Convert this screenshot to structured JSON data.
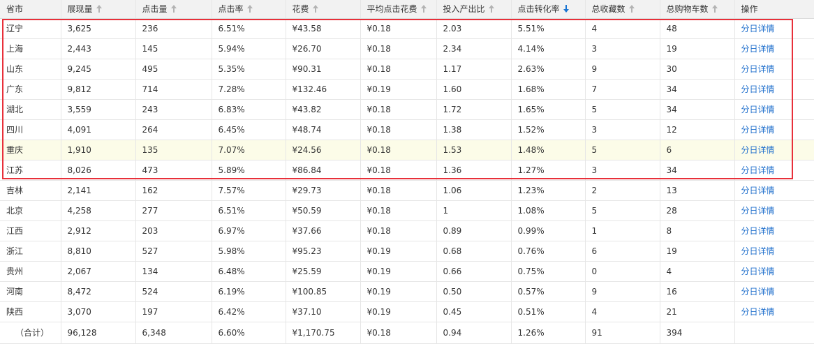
{
  "columns": [
    {
      "key": "province",
      "label": "省市",
      "sort": "none"
    },
    {
      "key": "impressions",
      "label": "展现量",
      "sort": "up"
    },
    {
      "key": "clicks",
      "label": "点击量",
      "sort": "up"
    },
    {
      "key": "ctr",
      "label": "点击率",
      "sort": "up"
    },
    {
      "key": "cost",
      "label": "花费",
      "sort": "up"
    },
    {
      "key": "cpc",
      "label": "平均点击花费",
      "sort": "up"
    },
    {
      "key": "roi",
      "label": "投入产出比",
      "sort": "up"
    },
    {
      "key": "cvr",
      "label": "点击转化率",
      "sort": "down-active"
    },
    {
      "key": "favorites",
      "label": "总收藏数",
      "sort": "up"
    },
    {
      "key": "cart",
      "label": "总购物车数",
      "sort": "up"
    },
    {
      "key": "action",
      "label": "操作",
      "sort": "none"
    }
  ],
  "action_link_label": "分日详情",
  "rows": [
    [
      "辽宁",
      "3,625",
      "236",
      "6.51%",
      "¥43.58",
      "¥0.18",
      "2.03",
      "5.51%",
      "4",
      "48"
    ],
    [
      "上海",
      "2,443",
      "145",
      "5.94%",
      "¥26.70",
      "¥0.18",
      "2.34",
      "4.14%",
      "3",
      "19"
    ],
    [
      "山东",
      "9,245",
      "495",
      "5.35%",
      "¥90.31",
      "¥0.18",
      "1.17",
      "2.63%",
      "9",
      "30"
    ],
    [
      "广东",
      "9,812",
      "714",
      "7.28%",
      "¥132.46",
      "¥0.19",
      "1.60",
      "1.68%",
      "7",
      "34"
    ],
    [
      "湖北",
      "3,559",
      "243",
      "6.83%",
      "¥43.82",
      "¥0.18",
      "1.72",
      "1.65%",
      "5",
      "34"
    ],
    [
      "四川",
      "4,091",
      "264",
      "6.45%",
      "¥48.74",
      "¥0.18",
      "1.38",
      "1.52%",
      "3",
      "12"
    ],
    [
      "重庆",
      "1,910",
      "135",
      "7.07%",
      "¥24.56",
      "¥0.18",
      "1.53",
      "1.48%",
      "5",
      "6"
    ],
    [
      "江苏",
      "8,026",
      "473",
      "5.89%",
      "¥86.84",
      "¥0.18",
      "1.36",
      "1.27%",
      "3",
      "34"
    ],
    [
      "吉林",
      "2,141",
      "162",
      "7.57%",
      "¥29.73",
      "¥0.18",
      "1.06",
      "1.23%",
      "2",
      "13"
    ],
    [
      "北京",
      "4,258",
      "277",
      "6.51%",
      "¥50.59",
      "¥0.18",
      "1",
      "1.08%",
      "5",
      "28"
    ],
    [
      "江西",
      "2,912",
      "203",
      "6.97%",
      "¥37.66",
      "¥0.18",
      "0.89",
      "0.99%",
      "1",
      "8"
    ],
    [
      "浙江",
      "8,810",
      "527",
      "5.98%",
      "¥95.23",
      "¥0.19",
      "0.68",
      "0.76%",
      "6",
      "19"
    ],
    [
      "贵州",
      "2,067",
      "134",
      "6.48%",
      "¥25.59",
      "¥0.19",
      "0.66",
      "0.75%",
      "0",
      "4"
    ],
    [
      "河南",
      "8,472",
      "524",
      "6.19%",
      "¥100.85",
      "¥0.19",
      "0.50",
      "0.57%",
      "9",
      "16"
    ],
    [
      "陕西",
      "3,070",
      "197",
      "6.42%",
      "¥37.10",
      "¥0.19",
      "0.45",
      "0.51%",
      "4",
      "21"
    ]
  ],
  "highlighted_row_index": 6,
  "total_row": [
    "（合计）",
    "96,128",
    "6,348",
    "6.60%",
    "¥1,170.75",
    "¥0.18",
    "0.94",
    "1.26%",
    "91",
    "394"
  ],
  "colors": {
    "highlight_box": "#e8303a",
    "link": "#1f6fcc",
    "sort_active": "#1a75d2",
    "row_highlight": "#fcfce8"
  }
}
